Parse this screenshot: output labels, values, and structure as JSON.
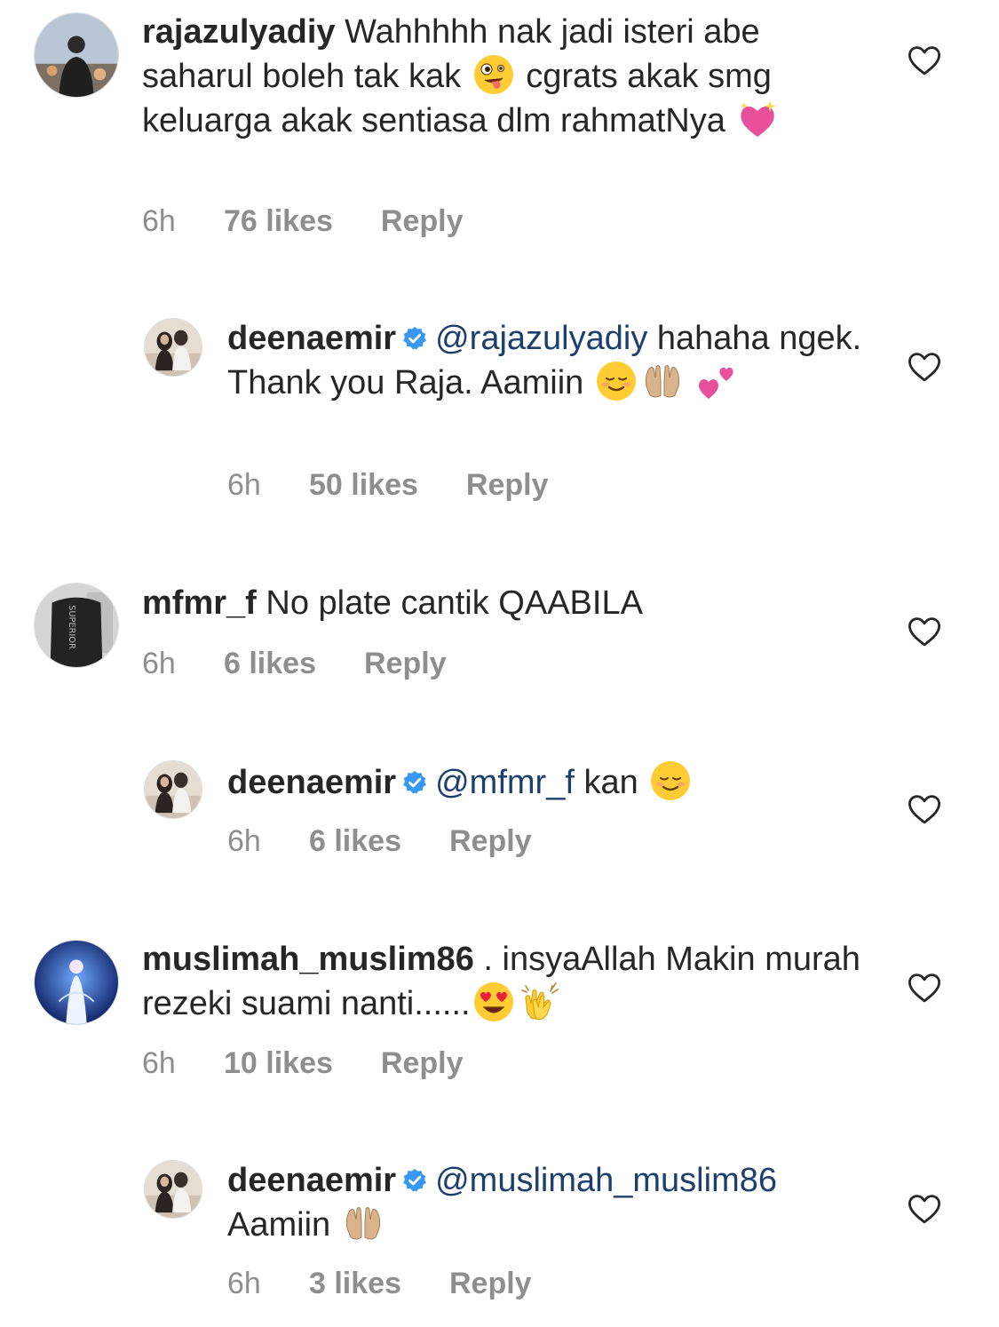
{
  "comments": [
    {
      "username": "rajazulyadiy",
      "text": "Wahhhhh nak jadi isteri abe saharul boleh tak kak",
      "text2": "cgrats akak smg keluarga akak sentiasa dlm rahmatNya",
      "emoji1": "zany-face-emoji",
      "emoji2": "sparkling-heart-emoji",
      "time": "6h",
      "likes": "76 likes",
      "reply": "Reply"
    },
    {
      "username": "deenaemir",
      "mention": "@rajazulyadiy",
      "text": "hahaha ngek. Thank you Raja. Aamiin",
      "time": "6h",
      "likes": "50 likes",
      "reply": "Reply"
    },
    {
      "username": "mfmr_f",
      "text": "No plate cantik QAABILA",
      "time": "6h",
      "likes": "6 likes",
      "reply": "Reply"
    },
    {
      "username": "deenaemir",
      "mention": "@mfmr_f",
      "text": "kan",
      "time": "6h",
      "likes": "6 likes",
      "reply": "Reply"
    },
    {
      "username": "muslimah_muslim86",
      "text": ". insyaAllah Makin murah rezeki suami nanti......",
      "time": "6h",
      "likes": "10 likes",
      "reply": "Reply"
    },
    {
      "username": "deenaemir",
      "mention": "@muslimah_muslim86",
      "text": "Aamiin",
      "time": "6h",
      "likes": "3 likes",
      "reply": "Reply"
    }
  ],
  "colors": {
    "text": "#262626",
    "meta": "#8e8e8e",
    "mention": "#1c3f6e",
    "verified": "#3897f0"
  }
}
